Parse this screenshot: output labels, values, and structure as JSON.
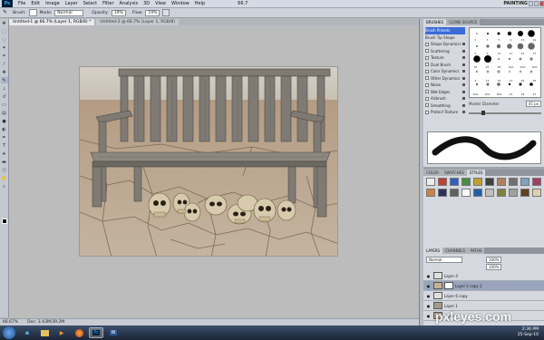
{
  "menubar": {
    "logo": "Ps",
    "items": [
      "File",
      "Edit",
      "Image",
      "Layer",
      "Select",
      "Filter",
      "Analysis",
      "3D",
      "View",
      "Window",
      "Help"
    ],
    "zoom": "66.7",
    "workspace": "PAINTING"
  },
  "options": {
    "brush_label": "Brush:",
    "mode_label": "Mode:",
    "mode_value": "Normal",
    "opacity_label": "Opacity:",
    "opacity_value": "19%",
    "flow_label": "Flow:",
    "flow_value": "19%"
  },
  "tabs": [
    {
      "label": "Untitled-1 @ 66.7% (Layer 1, RGB/8) *"
    },
    {
      "label": "Untitled-2 @ 66.7% (Layer 1, RGB/8)"
    }
  ],
  "status": {
    "zoom": "66.67%",
    "doc": "Doc: 3.43M/39.2M"
  },
  "brushes": {
    "tabs": [
      "BRUSHES",
      "CLONE SOURCE"
    ],
    "items": [
      {
        "label": "Brush Presets",
        "checkbox": false
      },
      {
        "label": "Brush Tip Shape",
        "checkbox": false
      },
      {
        "label": "Shape Dynamics",
        "checkbox": true
      },
      {
        "label": "Scattering",
        "checkbox": true
      },
      {
        "label": "Texture",
        "checkbox": true
      },
      {
        "label": "Dual Brush",
        "checkbox": true
      },
      {
        "label": "Color Dynamics",
        "checkbox": true
      },
      {
        "label": "Other Dynamics",
        "checkbox": true
      },
      {
        "label": "Noise",
        "checkbox": true
      },
      {
        "label": "Wet Edges",
        "checkbox": true
      },
      {
        "label": "Airbrush",
        "checkbox": true
      },
      {
        "label": "Smoothing",
        "checkbox": true
      },
      {
        "label": "Protect Texture",
        "checkbox": true
      }
    ],
    "master_diameter_label": "Master Diameter",
    "master_diameter_value": "45 px",
    "sizes": [
      "1",
      "3",
      "5",
      "9",
      "13",
      "19",
      "5",
      "9",
      "13",
      "17",
      "21",
      "27",
      "35",
      "45",
      "65",
      "100",
      "200",
      "300",
      "9",
      "13",
      "19",
      "17",
      "45",
      "65",
      "100",
      "200",
      "300",
      "14",
      "24",
      "27"
    ]
  },
  "styles": {
    "tabs": [
      "COLOR",
      "SWATCHES",
      "STYLES"
    ],
    "colors": [
      "#eeeeee",
      "#c04030",
      "#3060c0",
      "#4a8a4a",
      "#c0a030",
      "#404040",
      "#b08060",
      "#707070",
      "#80a0c0",
      "#a04060",
      "#d08040",
      "#303060",
      "#606060",
      "#ffffff",
      "#2060a0",
      "#c0c0c0",
      "#808040",
      "#a0a0a0",
      "#604020",
      "#e0d0b0"
    ]
  },
  "layers": {
    "tabs": [
      "LAYERS",
      "CHANNELS",
      "PATHS"
    ],
    "blend": "Normal",
    "opacity": "100%",
    "fill": "100%",
    "rows": [
      {
        "name": "Layer 4"
      },
      {
        "name": "Layer 1 copy 2"
      },
      {
        "name": "Layer 6 copy"
      },
      {
        "name": "Layer 1"
      },
      {
        "name": "Layer 2"
      }
    ]
  },
  "taskbar": {
    "apps": [
      "IE",
      "Folder",
      "WMP",
      "Firefox",
      "Ps",
      "Word"
    ],
    "time": "2:36 PM",
    "date": "25-Sep-10"
  },
  "watermark": "pxleyes.com"
}
